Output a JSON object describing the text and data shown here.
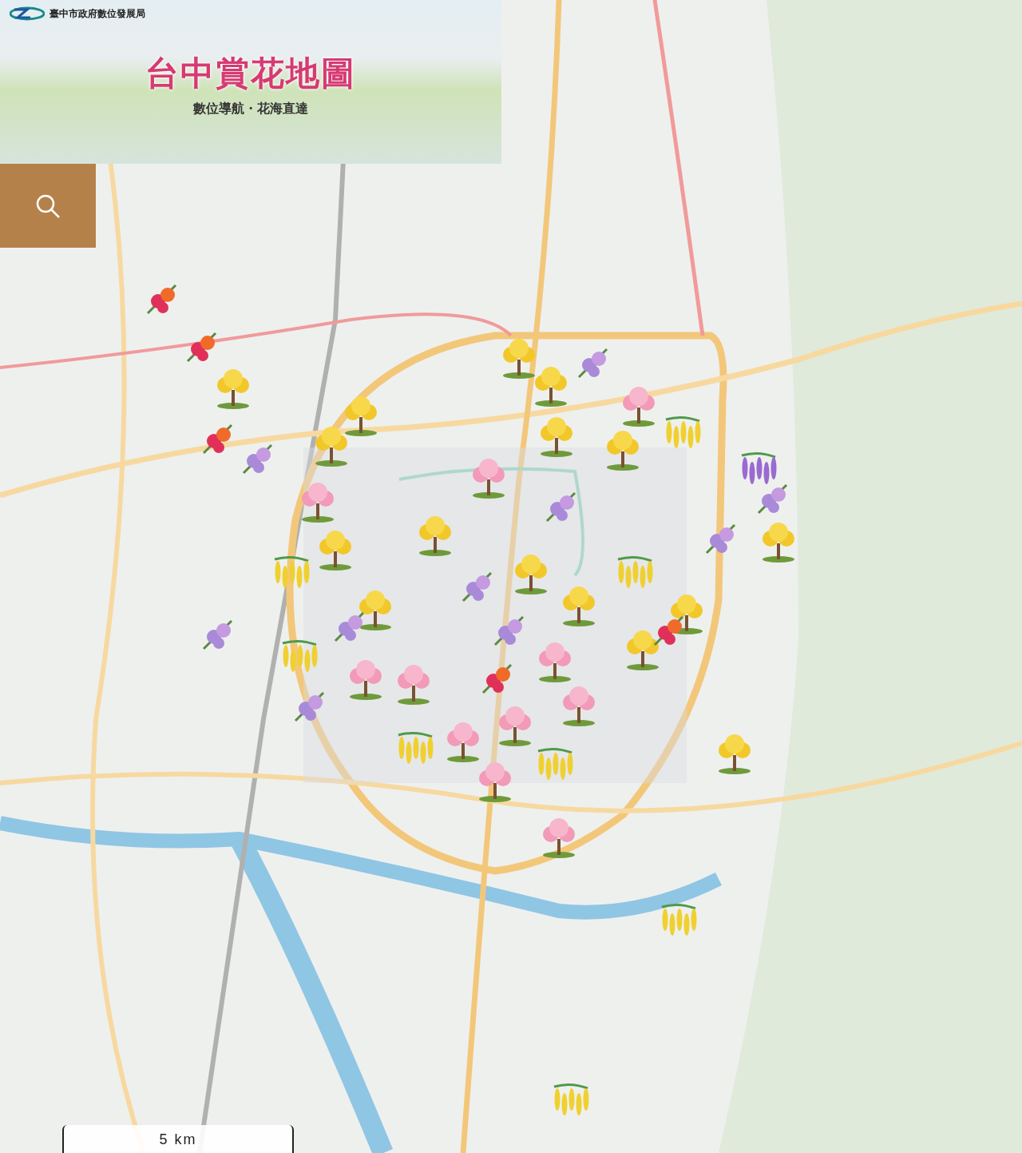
{
  "banner": {
    "agency": "臺中市政府數位發展局",
    "title": "台中賞花地圖",
    "subtitle": "數位導航・花海直達"
  },
  "map": {
    "markers": [
      {
        "kind": "trumpet"
      },
      {
        "kind": "trumpet"
      },
      {
        "kind": "trumpet"
      },
      {
        "kind": "trumpet"
      },
      {
        "kind": "trumpet"
      },
      {
        "kind": "trumpet"
      },
      {
        "kind": "trumpet"
      },
      {
        "kind": "trumpet"
      },
      {
        "kind": "trumpet"
      },
      {
        "kind": "trumpet"
      },
      {
        "kind": "trumpet"
      },
      {
        "kind": "trumpet"
      },
      {
        "kind": "trumpet"
      },
      {
        "kind": "trumpet"
      },
      {
        "kind": "trumpet"
      },
      {
        "kind": "trumpet"
      },
      {
        "kind": "cherry"
      },
      {
        "kind": "cherry"
      },
      {
        "kind": "cherry"
      },
      {
        "kind": "cherry"
      },
      {
        "kind": "cherry"
      },
      {
        "kind": "cherry"
      },
      {
        "kind": "cherry"
      },
      {
        "kind": "cherry"
      },
      {
        "kind": "cherry"
      },
      {
        "kind": "cherry"
      },
      {
        "kind": "cherry"
      },
      {
        "kind": "jacaranda"
      },
      {
        "kind": "jacaranda"
      },
      {
        "kind": "jacaranda"
      },
      {
        "kind": "jacaranda"
      },
      {
        "kind": "jacaranda"
      },
      {
        "kind": "jacaranda"
      },
      {
        "kind": "jacaranda"
      },
      {
        "kind": "jacaranda"
      },
      {
        "kind": "jacaranda"
      },
      {
        "kind": "jacaranda"
      },
      {
        "kind": "bougainvillea"
      },
      {
        "kind": "bougainvillea"
      },
      {
        "kind": "bougainvillea"
      },
      {
        "kind": "bougainvillea"
      },
      {
        "kind": "bougainvillea"
      },
      {
        "kind": "golden-shower"
      },
      {
        "kind": "golden-shower"
      },
      {
        "kind": "golden-shower"
      },
      {
        "kind": "golden-shower"
      },
      {
        "kind": "golden-shower"
      },
      {
        "kind": "golden-shower"
      },
      {
        "kind": "golden-shower"
      },
      {
        "kind": "golden-shower"
      },
      {
        "kind": "wisteria"
      }
    ]
  },
  "scale_bar": {
    "label": "5 km"
  }
}
